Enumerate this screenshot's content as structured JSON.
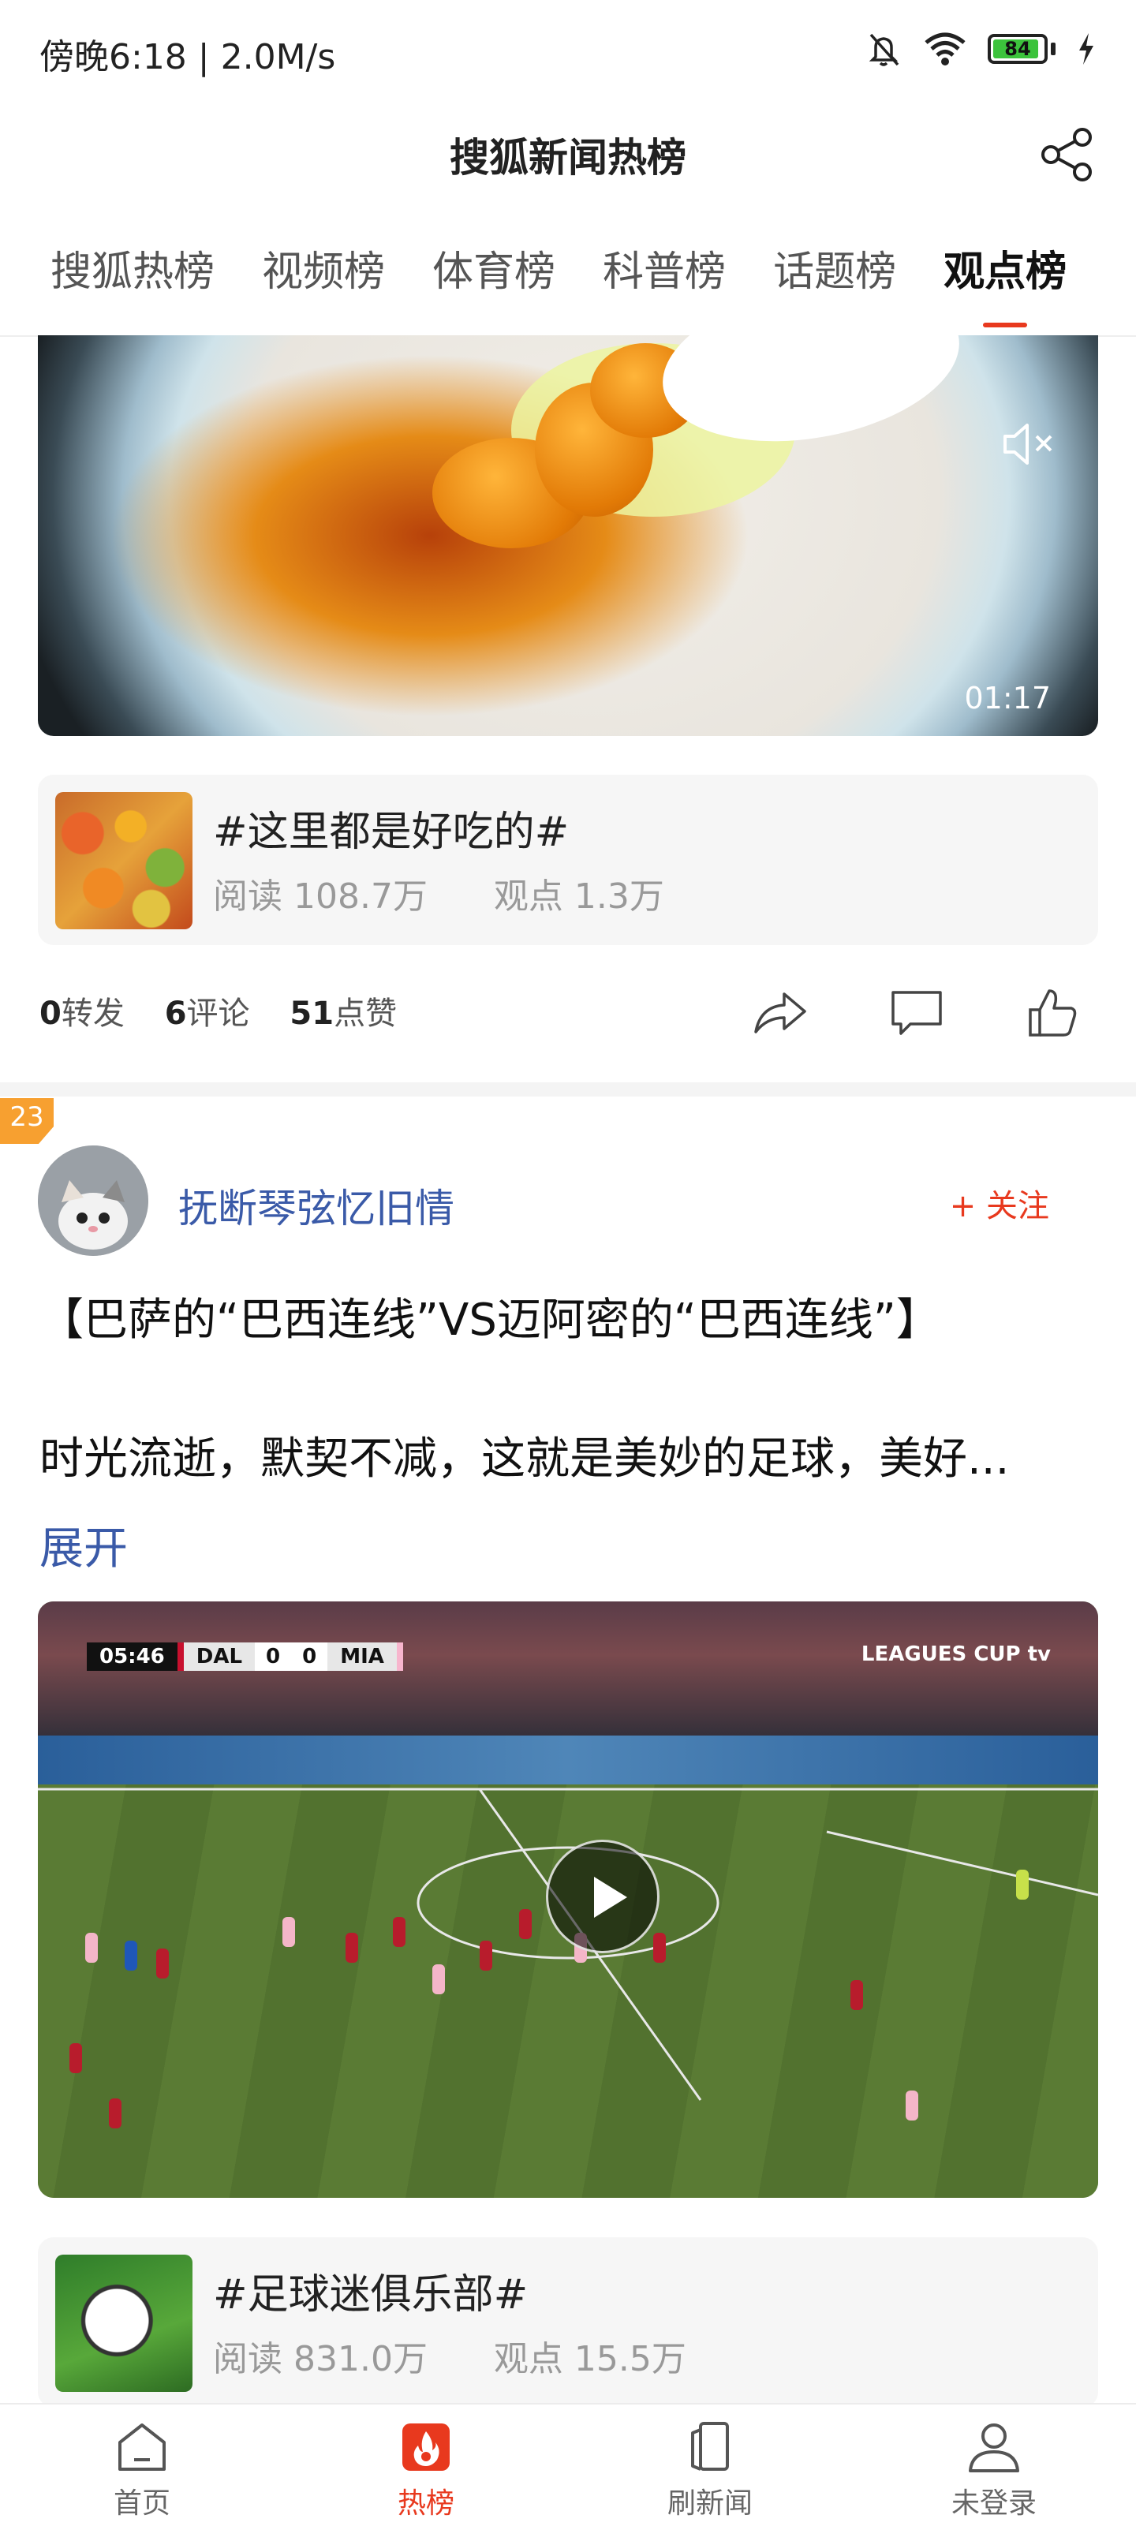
{
  "status_bar": {
    "time": "傍晚6:18 | 2.0M/s",
    "battery_level": "84"
  },
  "header": {
    "title": "搜狐新闻热榜"
  },
  "tabs": [
    {
      "label": "搜狐热榜",
      "active": false
    },
    {
      "label": "视频榜",
      "active": false
    },
    {
      "label": "体育榜",
      "active": false
    },
    {
      "label": "科普榜",
      "active": false
    },
    {
      "label": "话题榜",
      "active": false
    },
    {
      "label": "观点榜",
      "active": true
    }
  ],
  "post1": {
    "video_duration": "01:17",
    "topic": {
      "title": "#这里都是好吃的#",
      "reads": "阅读 108.7万",
      "views": "观点 1.3万"
    },
    "stats": {
      "shares_count": "0",
      "shares_label": "转发",
      "comments_count": "6",
      "comments_label": "评论",
      "likes_count": "51",
      "likes_label": "点赞"
    }
  },
  "post2": {
    "rank": "23",
    "author": "抚断琴弦忆旧情",
    "follow_label": "+ 关注",
    "title": "【巴萨的“巴西连线”VS迈阿密的“巴西连线”】",
    "body": "时光流逝，默契不减，这就是美妙的足球，美好...",
    "expand_label": "展开",
    "video": {
      "scoreboard_time": "05:46",
      "team_home": "DAL",
      "score_home": "0",
      "score_away": "0",
      "team_away": "MIA",
      "broadcast": "LEAGUES CUP  tv"
    },
    "topic": {
      "title": "#足球迷俱乐部#",
      "reads": "阅读 831.0万",
      "views": "观点 15.5万"
    }
  },
  "bottom_nav": [
    {
      "label": "首页",
      "icon": "home-icon",
      "active": false
    },
    {
      "label": "热榜",
      "icon": "hot-flame-icon",
      "active": true
    },
    {
      "label": "刷新闻",
      "icon": "cards-icon",
      "active": false
    },
    {
      "label": "未登录",
      "icon": "user-icon",
      "active": false
    }
  ],
  "colors": {
    "accent": "#e8391e",
    "link": "#3a5aa8",
    "rank_badge": "#f7a030"
  }
}
